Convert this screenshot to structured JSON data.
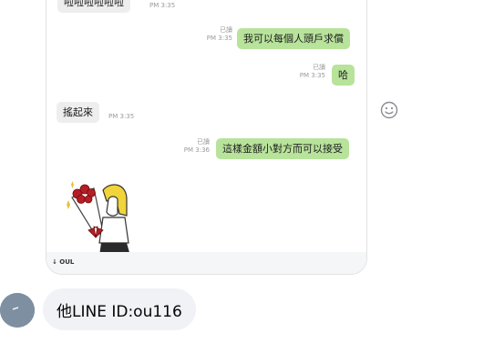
{
  "chat": {
    "messages": [
      {
        "text": "啦啦啦啦啦啦",
        "status": "",
        "time": "PM 3:35"
      },
      {
        "text": "我可以每個人頭戶求償",
        "status": "已讀",
        "time": "PM 3:35"
      },
      {
        "text": "哈",
        "status": "已讀",
        "time": "PM 3:35"
      },
      {
        "text": "搖起來",
        "status": "",
        "time": "PM 3:35"
      },
      {
        "text": "這樣金額小對方而可以接受",
        "status": "已讀",
        "time": "PM 3:36"
      }
    ],
    "bottom_label": "↓ OUL",
    "sticker_icon": "rose-bouquet-sticker"
  },
  "emoji_icon": "smiley-face-icon",
  "comment": {
    "text": "他LINE ID:ou116",
    "avatar_icon": "user-avatar"
  }
}
